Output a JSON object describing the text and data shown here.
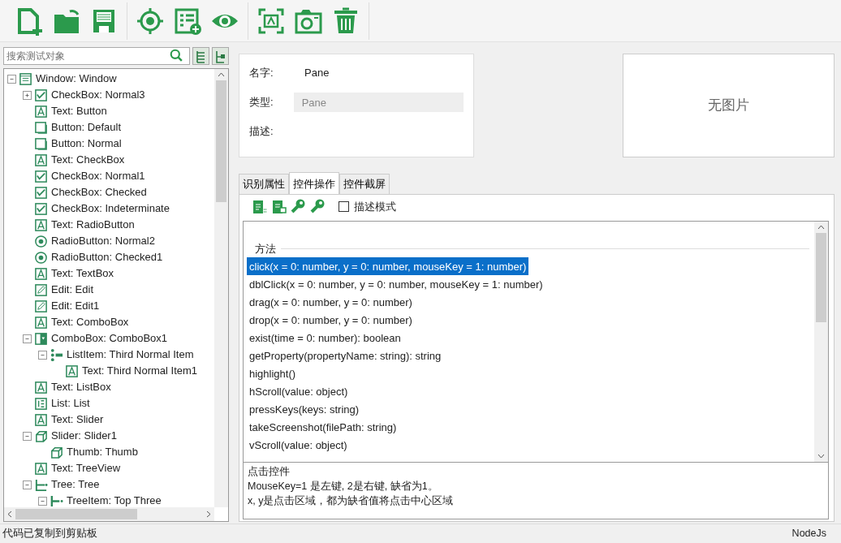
{
  "search": {
    "placeholder": "搜索测试对象"
  },
  "tree": [
    {
      "label": "Window: Window",
      "kind": "window",
      "expanded": true,
      "children": [
        {
          "label": "CheckBox: Normal3",
          "kind": "checkbox",
          "expanded": false
        },
        {
          "label": "Text: Button",
          "kind": "text"
        },
        {
          "label": "Button: Default",
          "kind": "button"
        },
        {
          "label": "Button: Normal",
          "kind": "button"
        },
        {
          "label": "Text: CheckBox",
          "kind": "text"
        },
        {
          "label": "CheckBox: Normal1",
          "kind": "checkbox"
        },
        {
          "label": "CheckBox: Checked",
          "kind": "checkbox"
        },
        {
          "label": "CheckBox: Indeterminate",
          "kind": "checkbox"
        },
        {
          "label": "Text: RadioButton",
          "kind": "text"
        },
        {
          "label": "RadioButton: Normal2",
          "kind": "radio"
        },
        {
          "label": "RadioButton: Checked1",
          "kind": "radio"
        },
        {
          "label": "Text: TextBox",
          "kind": "text"
        },
        {
          "label": "Edit: Edit",
          "kind": "edit"
        },
        {
          "label": "Edit: Edit1",
          "kind": "edit"
        },
        {
          "label": "Text: ComboBox",
          "kind": "text"
        },
        {
          "label": "ComboBox: ComboBox1",
          "kind": "combobox",
          "expanded": true,
          "children": [
            {
              "label": "ListItem: Third Normal Item",
              "kind": "listitem",
              "expanded": true,
              "children": [
                {
                  "label": "Text: Third Normal Item1",
                  "kind": "text"
                }
              ]
            }
          ]
        },
        {
          "label": "Text: ListBox",
          "kind": "text"
        },
        {
          "label": "List: List",
          "kind": "list"
        },
        {
          "label": "Text: Slider",
          "kind": "text"
        },
        {
          "label": "Slider: Slider1",
          "kind": "slider",
          "expanded": true,
          "children": [
            {
              "label": "Thumb: Thumb",
              "kind": "slider"
            }
          ]
        },
        {
          "label": "Text: TreeView",
          "kind": "text"
        },
        {
          "label": "Tree: Tree",
          "kind": "tree",
          "expanded": true,
          "children": [
            {
              "label": "TreeItem: Top Three",
              "kind": "treeitem",
              "expanded": true
            }
          ]
        }
      ]
    }
  ],
  "properties": [
    {
      "label": "名字:",
      "value": "Pane",
      "kind": "plain"
    },
    {
      "label": "类型:",
      "value": "Pane",
      "kind": "input"
    },
    {
      "label": "描述:"
    }
  ],
  "image_placeholder": "无图片",
  "tabs": [
    {
      "label": "识别属性",
      "selected": false
    },
    {
      "label": "控件操作",
      "selected": true
    },
    {
      "label": "控件截屏",
      "selected": false
    }
  ],
  "panel_toolbar": {
    "checkbox": {
      "label": "描述模式",
      "checked": false
    }
  },
  "methods": {
    "heading": "方法",
    "items": [
      {
        "text": "click(x = 0: number, y = 0: number, mouseKey = 1: number)",
        "selected": true
      },
      {
        "text": "dblClick(x = 0: number, y = 0: number, mouseKey = 1: number)",
        "selected": false
      },
      {
        "text": "drag(x = 0: number, y = 0: number)",
        "selected": false
      },
      {
        "text": "drop(x = 0: number, y = 0: number)",
        "selected": false
      },
      {
        "text": "exist(time = 0: number): boolean",
        "selected": false
      },
      {
        "text": "getProperty(propertyName: string): string",
        "selected": false
      },
      {
        "text": "highlight()",
        "selected": false
      },
      {
        "text": "hScroll(value: object)",
        "selected": false
      },
      {
        "text": "pressKeys(keys: string)",
        "selected": false
      },
      {
        "text": "takeScreenshot(filePath: string)",
        "selected": false
      },
      {
        "text": "vScroll(value: object)",
        "selected": false
      }
    ]
  },
  "description": [
    "点击控件",
    "MouseKey=1 是左键, 2是右键, 缺省为1。",
    "x, y是点击区域，都为缺省值将点击中心区域"
  ],
  "status_bar": {
    "message": "代码已复制到剪贴板",
    "language": "NodeJs"
  }
}
